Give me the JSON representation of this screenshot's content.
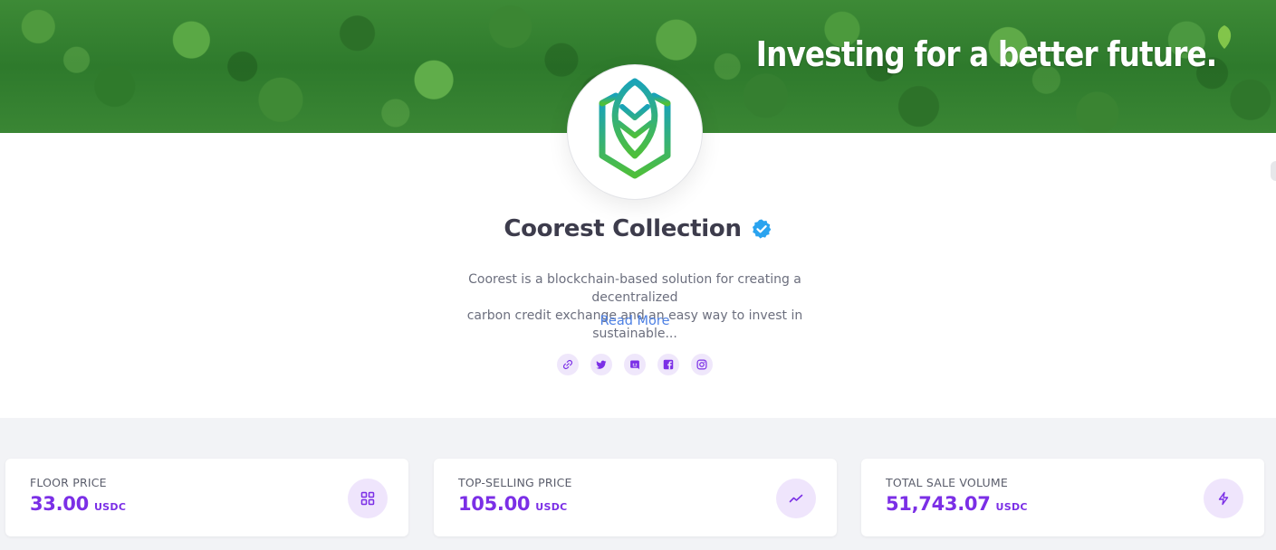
{
  "banner": {
    "tagline": "Investing for a better future."
  },
  "collection": {
    "name": "Coorest Collection",
    "description_line1": "Coorest is a blockchain-based solution for creating a decentralized",
    "description_line2": "carbon credit exchange and an easy way to invest in sustainable...",
    "read_more_label": "Read More",
    "verified": true
  },
  "socials": [
    {
      "icon": "link-icon"
    },
    {
      "icon": "twitter-icon"
    },
    {
      "icon": "discord-icon"
    },
    {
      "icon": "facebook-icon"
    },
    {
      "icon": "instagram-icon"
    }
  ],
  "stats": [
    {
      "label": "FLOOR PRICE",
      "value": "33.00",
      "unit": "USDC",
      "icon": "grid-icon"
    },
    {
      "label": "TOP-SELLING PRICE",
      "value": "105.00",
      "unit": "USDC",
      "icon": "trend-icon"
    },
    {
      "label": "TOTAL SALE VOLUME",
      "value": "51,743.07",
      "unit": "USDC",
      "icon": "bolt-icon"
    }
  ],
  "colors": {
    "accent": "#7b2fe6",
    "link": "#4d80e4",
    "verified": "#2aa3ef",
    "icon_bg": "#efe5fc",
    "title": "#3d3c4c"
  }
}
